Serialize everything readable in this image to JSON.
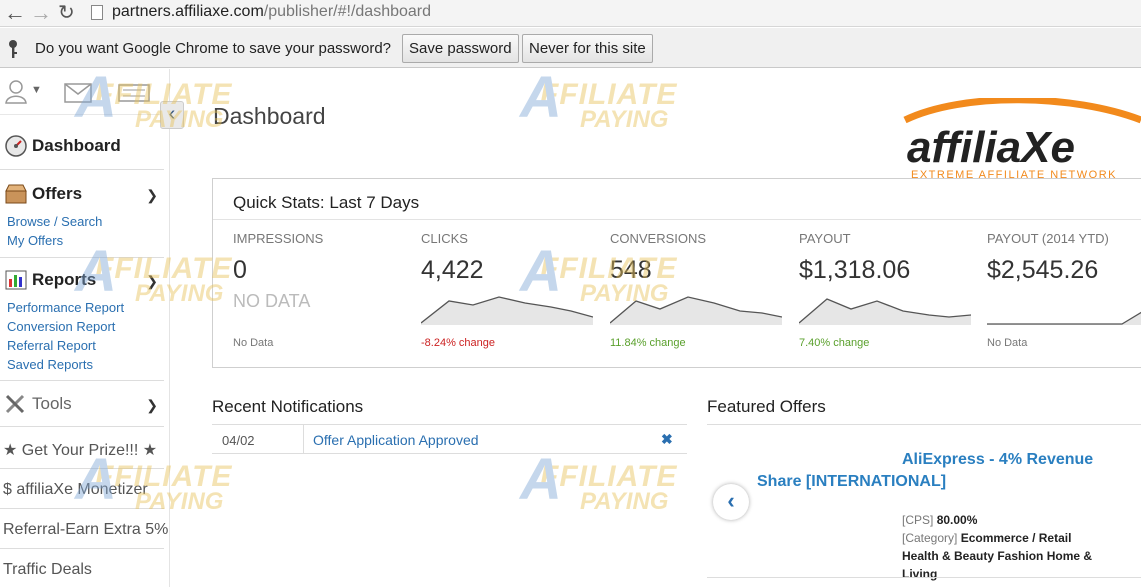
{
  "browser": {
    "url_host": "partners.affiliaxe.com",
    "url_path": "/publisher/#!/dashboard"
  },
  "password_bar": {
    "message": "Do you want Google Chrome to save your password?",
    "save_label": "Save password",
    "never_label": "Never for this site"
  },
  "sidebar": {
    "dashboard": "Dashboard",
    "offers": "Offers",
    "offers_links": [
      "Browse / Search",
      "My Offers"
    ],
    "reports": "Reports",
    "reports_links": [
      "Performance Report",
      "Conversion Report",
      "Referral Report",
      "Saved Reports"
    ],
    "tools": "Tools",
    "prize": "Get Your Prize!!!",
    "monetizer": "$ affiliaXe Monetizer",
    "referral": "Referral-Earn Extra 5%",
    "traffic": "Traffic Deals"
  },
  "page": {
    "title": "Dashboard",
    "logo_text": "affiliaXe",
    "logo_tagline": "EXTREME AFFILIATE NETWORK"
  },
  "quick_stats": {
    "title": "Quick Stats: Last 7 Days",
    "items": [
      {
        "label": "IMPRESSIONS",
        "value": "0",
        "nodata": "NO DATA",
        "change": "No Data",
        "change_color": "#777777"
      },
      {
        "label": "CLICKS",
        "value": "4,422",
        "change": "-8.24% change",
        "change_color": "#cc2222"
      },
      {
        "label": "CONVERSIONS",
        "value": "548",
        "change": "11.84% change",
        "change_color": "#5aa02c"
      },
      {
        "label": "PAYOUT",
        "value": "$1,318.06",
        "change": "7.40% change",
        "change_color": "#5aa02c"
      },
      {
        "label": "PAYOUT (2014 YTD)",
        "value": "$2,545.26",
        "change": "No Data",
        "change_color": "#777777"
      }
    ]
  },
  "notifications": {
    "title": "Recent Notifications",
    "rows": [
      {
        "date": "04/02",
        "message": "Offer Application Approved"
      }
    ]
  },
  "featured": {
    "title": "Featured Offers",
    "name_line1": "AliExpress - 4% Revenue",
    "name_line2": "Share [INTERNATIONAL]",
    "cps_key": "[CPS]",
    "cps_value": "80.00%",
    "category_key": "[Category]",
    "category_value": "Ecommerce / Retail Health & Beauty Fashion Home & Living"
  },
  "watermark": {
    "line1": "FFILIATE",
    "line2": "PAYING",
    "letter": "A"
  },
  "colors": {
    "link": "#2a6fb0",
    "accent_orange": "#f28a1c",
    "positive": "#5aa02c",
    "negative": "#cc2222"
  }
}
